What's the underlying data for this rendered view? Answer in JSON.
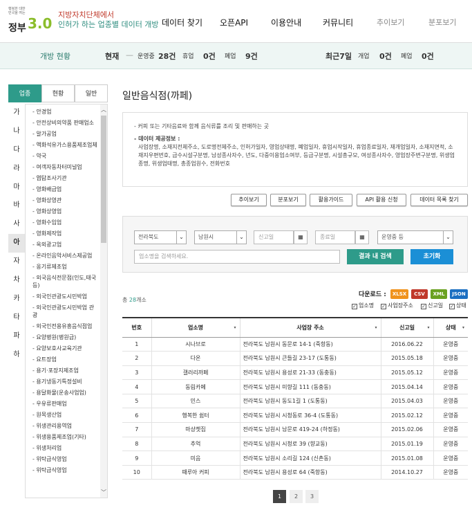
{
  "header": {
    "logo_small": "행복한 대한민국을 여는",
    "logo_gov": "정부",
    "logo_ver": "3.0",
    "logo_line1": "지방자치단체에서",
    "logo_line2": "인허가 하는 업종별 데이터 개방",
    "nav": [
      "데이터 찾기",
      "오픈API",
      "이용안내",
      "커뮤니티"
    ],
    "subnav": [
      "추이보기",
      "분포보기"
    ]
  },
  "status": {
    "title": "개방 현황",
    "current_label": "현재",
    "dash": "—",
    "op_label": "운영중",
    "op_val": "28건",
    "closed_label": "휴업",
    "closed_val": "0건",
    "shut_label": "폐업",
    "shut_val": "9건",
    "recent_label": "최근7일",
    "open_label": "개업",
    "open_val": "0건",
    "shut2_label": "폐업",
    "shut2_val": "0건"
  },
  "sidebar": {
    "tabs": [
      "업종",
      "현황",
      "일반"
    ],
    "index": [
      "가",
      "나",
      "다",
      "라",
      "마",
      "바",
      "사",
      "아",
      "자",
      "차",
      "카",
      "타",
      "파",
      "하"
    ],
    "active_index": "아",
    "items": [
      "- 안경업",
      "- 안전상비의약품 판매업소",
      "- 알가공업",
      "- 액화석유가스용품제조업체",
      "- 약국",
      "- 여객자동차터미널업",
      "- 엽탐조사기관",
      "- 영화배급업",
      "- 영화상영관",
      "- 영화상영업",
      "- 영화수입업",
      "- 영화제작업",
      "- 옥외광고업",
      "- 온라인음악서비스제공업",
      "- 옹기류제조업",
      "- 외국음식전문점(인도,태국등)",
      "- 외국인관광도시민박업",
      "- 외국인관광도시민박업 관광",
      "- 외국인전용유흥음식점업",
      "- 요양병원(병원급)",
      "- 요양보호사교육기관",
      "- 요트장업",
      "- 용기·포장지제조업",
      "- 용기냉동기특정설비",
      "- 용달화물(운송사업업)",
      "- 우유류판매업",
      "- 원목생산업",
      "- 위생관리용역업",
      "- 위생용품제조업(기타)",
      "- 위생처리업",
      "- 위탁급식영업",
      "- 위탁급식영업"
    ]
  },
  "main": {
    "title": "일반음식점(까페)",
    "desc_line": "- 커피 또는 기타음료와 함께 음식류를 조리 및 판매하는 곳",
    "info_head": "- 데이터 제공정보 :",
    "info_text": "사업장명, 소재지전체주소, 도로명전체주소, 인허가일자, 영업상태명, 폐업일자, 휴업시작일자, 휴업종료일자, 재개업일자, 소재지면적, 소재지우편번호, 급수시설구분명, 남성종사자수, 년도, 다중이용업소여부, 등급구분명, 시설총규모, 여성종사자수, 영업장주변구분명, 위생업종명, 위생업태명, 총종업원수, 전화번호",
    "buttons": [
      "추이보기",
      "분포보기",
      "활용가이드",
      "API 활용 신청",
      "데이터 목록 찾기"
    ],
    "filter": {
      "province": "전라북도",
      "city": "남원시",
      "start_ph": "신고일",
      "end_ph": "종료일",
      "status": "운영중 등",
      "search_ph": "업소명을 검색하세요.",
      "search_btn": "결과 내 검색",
      "reset_btn": "초기화"
    },
    "count_prefix": "총 ",
    "count": "28",
    "count_suffix": "개소",
    "download_label": "다운로드 :",
    "formats": [
      "XLSX",
      "CSV",
      "XML",
      "JSON"
    ],
    "format_colors": [
      "#f0931d",
      "#c0392b",
      "#6aa121",
      "#1b6fc2"
    ],
    "checks": [
      "업소명",
      "사업장주소",
      "신고일",
      "상태"
    ],
    "columns": [
      "번호",
      "업소명",
      "사업장 주소",
      "신고일",
      "상태"
    ],
    "rows": [
      [
        "1",
        "시나브로",
        "전라북도 남원시 동문로 14-1 (죽항동)",
        "2016.06.22",
        "운영중"
      ],
      [
        "2",
        "다온",
        "전라북도 남원시 큰들길 23-17 (도통동)",
        "2015.05.18",
        "운영중"
      ],
      [
        "3",
        "갤러리까페",
        "전라북도 남원시 용성로 21-33 (동충동)",
        "2015.05.12",
        "운영중"
      ],
      [
        "4",
        "동림카페",
        "전라북도 남원시 미향길 111 (동충동)",
        "2015.04.14",
        "운영중"
      ],
      [
        "5",
        "민스",
        "전라북도 남원시 동도1길 1 (도통동)",
        "2015.04.03",
        "운영중"
      ],
      [
        "6",
        "행복한 쉼터",
        "전라북도 남원시 시청동로 36-4 (도통동)",
        "2015.02.12",
        "운영중"
      ],
      [
        "7",
        "마샹쳇집",
        "전라북도 남원시 남문로 419-24 (하정동)",
        "2015.02.06",
        "운영중"
      ],
      [
        "8",
        "추억",
        "전라북도 남원시 시청로 39 (향교동)",
        "2015.01.19",
        "운영중"
      ],
      [
        "9",
        "미음",
        "전라북도 남원시 소리길 124 (신촌동)",
        "2015.01.08",
        "운영중"
      ],
      [
        "10",
        "때루아 커피",
        "전라북도 남원시 용성로 64 (죽항동)",
        "2014.10.27",
        "운영중"
      ]
    ],
    "pages": [
      "1",
      "2",
      "3"
    ]
  }
}
